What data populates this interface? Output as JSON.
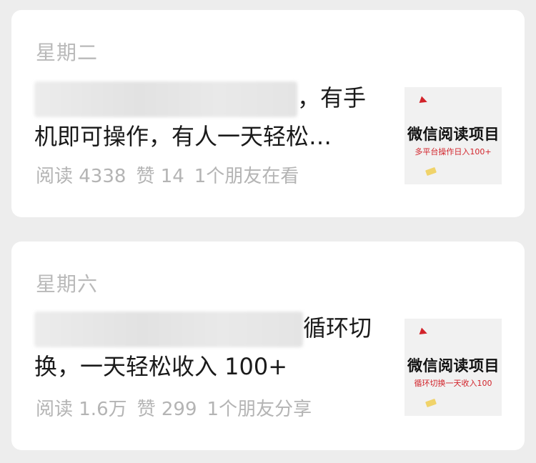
{
  "articles": [
    {
      "day": "星期二",
      "title_line1_suffix": "，有手",
      "title_line2": "机即可操作，有人一天轻松…",
      "reads": "阅读 4338",
      "likes": "赞 14",
      "social": "1个朋友在看",
      "thumb_title": "微信阅读项目",
      "thumb_subtitle": "多平台操作日入100+"
    },
    {
      "day": "星期六",
      "title_line1_suffix": "循环切",
      "title_line2": "换，一天轻松收入 100+",
      "reads": "阅读 1.6万",
      "likes": "赞 299",
      "social": "1个朋友分享",
      "thumb_title": "微信阅读项目",
      "thumb_subtitle": "循环切换一天收入100"
    }
  ]
}
